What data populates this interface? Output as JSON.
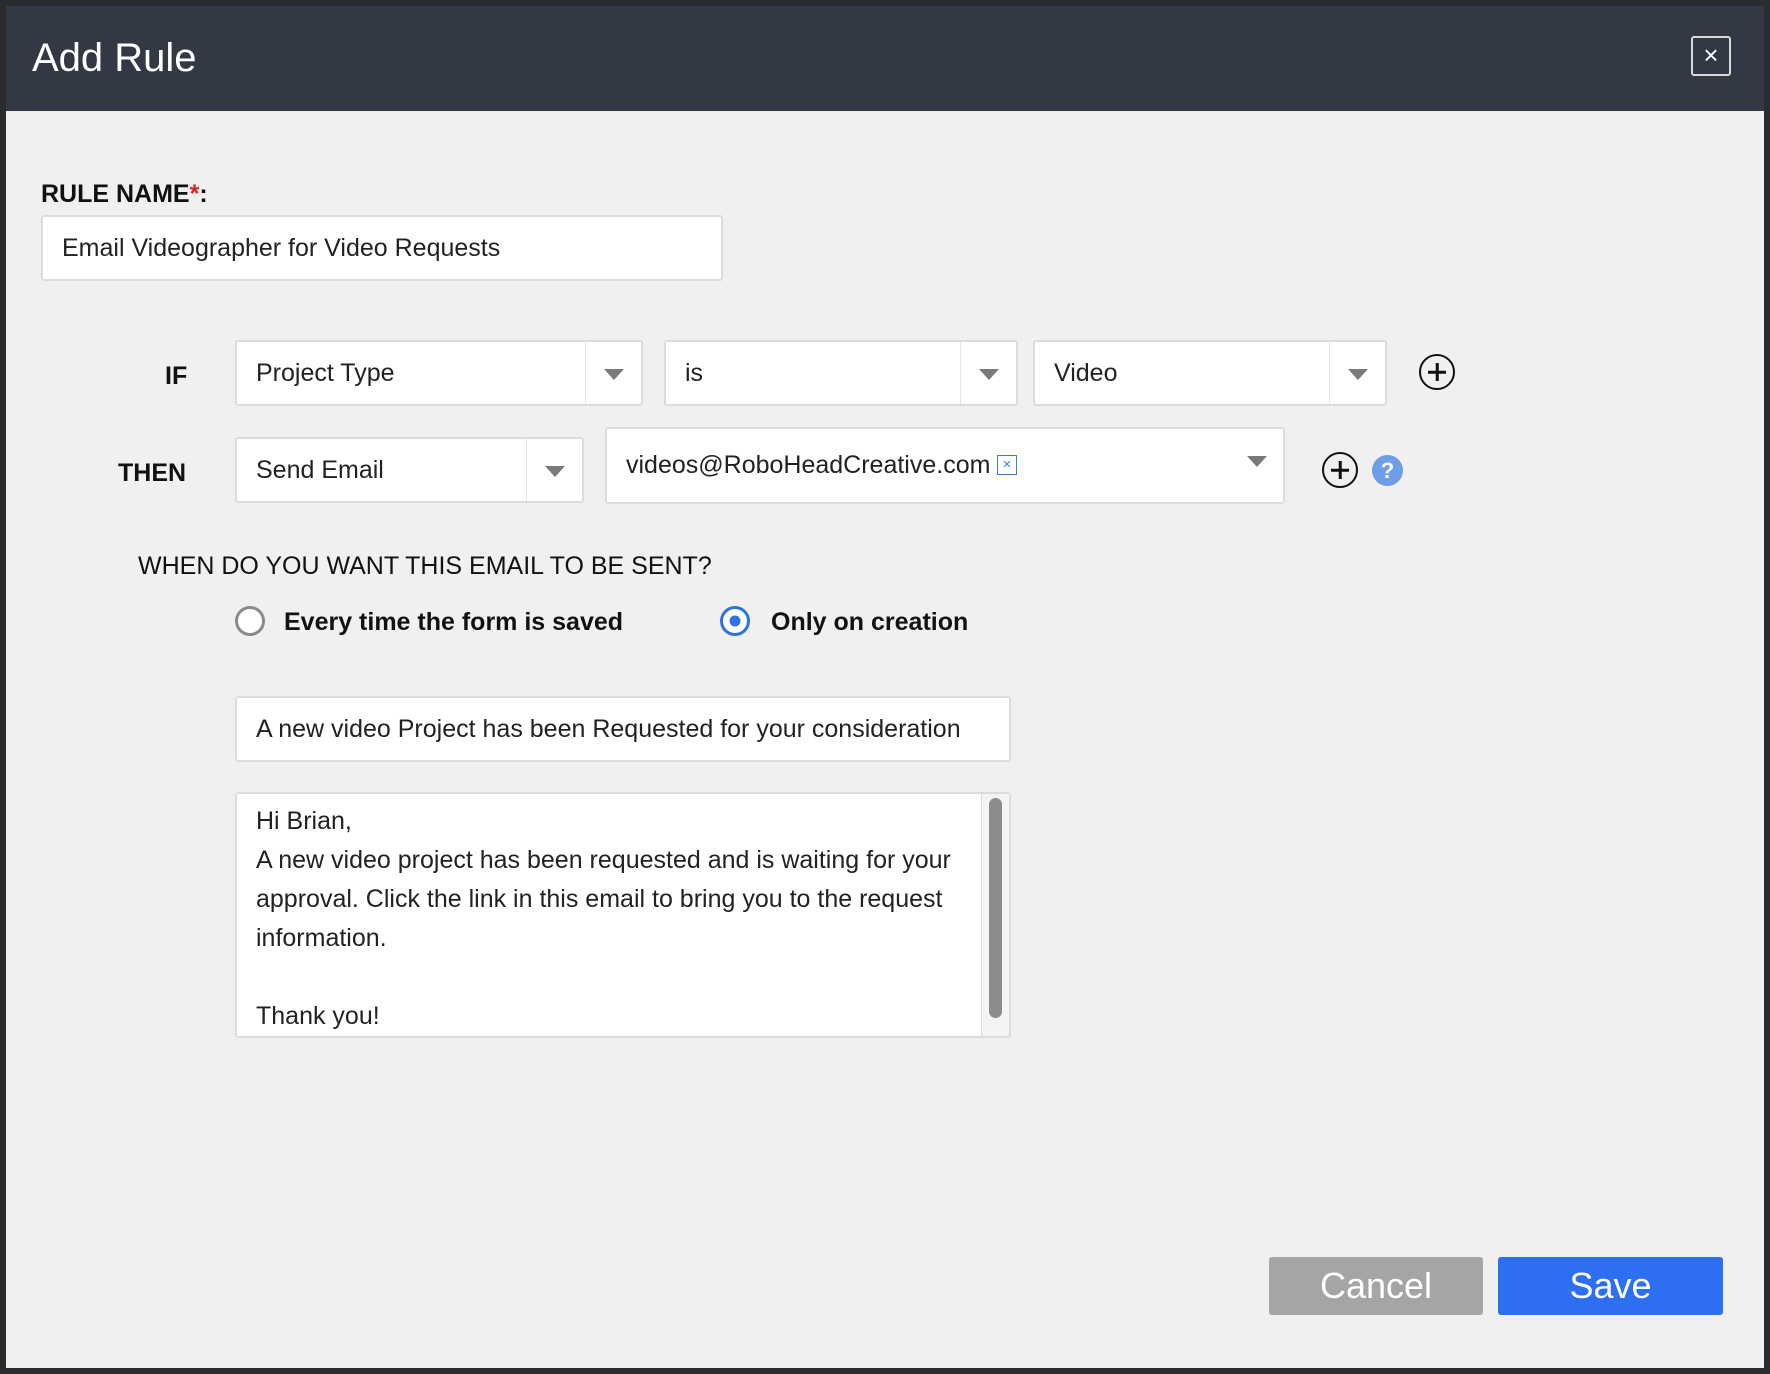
{
  "dialog": {
    "title": "Add Rule",
    "close_label": "×"
  },
  "rule_name": {
    "label": "RULE NAME",
    "required_mark": "*",
    "colon": ":",
    "value": "Email Videographer for Video Requests"
  },
  "condition": {
    "if_label": "IF",
    "field": "Project Type",
    "operator": "is",
    "value": "Video"
  },
  "action": {
    "then_label": "THEN",
    "type": "Send Email",
    "recipient": "videos@RoboHeadCreative.com",
    "recipient_remove": "×",
    "help_label": "?"
  },
  "timing": {
    "question": "WHEN DO YOU WANT THIS EMAIL TO BE SENT?",
    "options": [
      {
        "label": "Every time the form is saved",
        "selected": false
      },
      {
        "label": "Only on creation",
        "selected": true
      }
    ]
  },
  "email": {
    "subject": "A new video Project has been Requested for your consideration",
    "body": "Hi Brian,\nA new video project has been requested and is waiting for your approval. Click the link in this email to bring you to the request information.\n\nThank you!"
  },
  "footer": {
    "cancel_label": "Cancel",
    "save_label": "Save"
  },
  "colors": {
    "header_bg": "#333845",
    "accent": "#2d6ff0",
    "cancel_bg": "#a5a5a5",
    "help_icon": "#6f9de8",
    "required": "#e02020"
  }
}
